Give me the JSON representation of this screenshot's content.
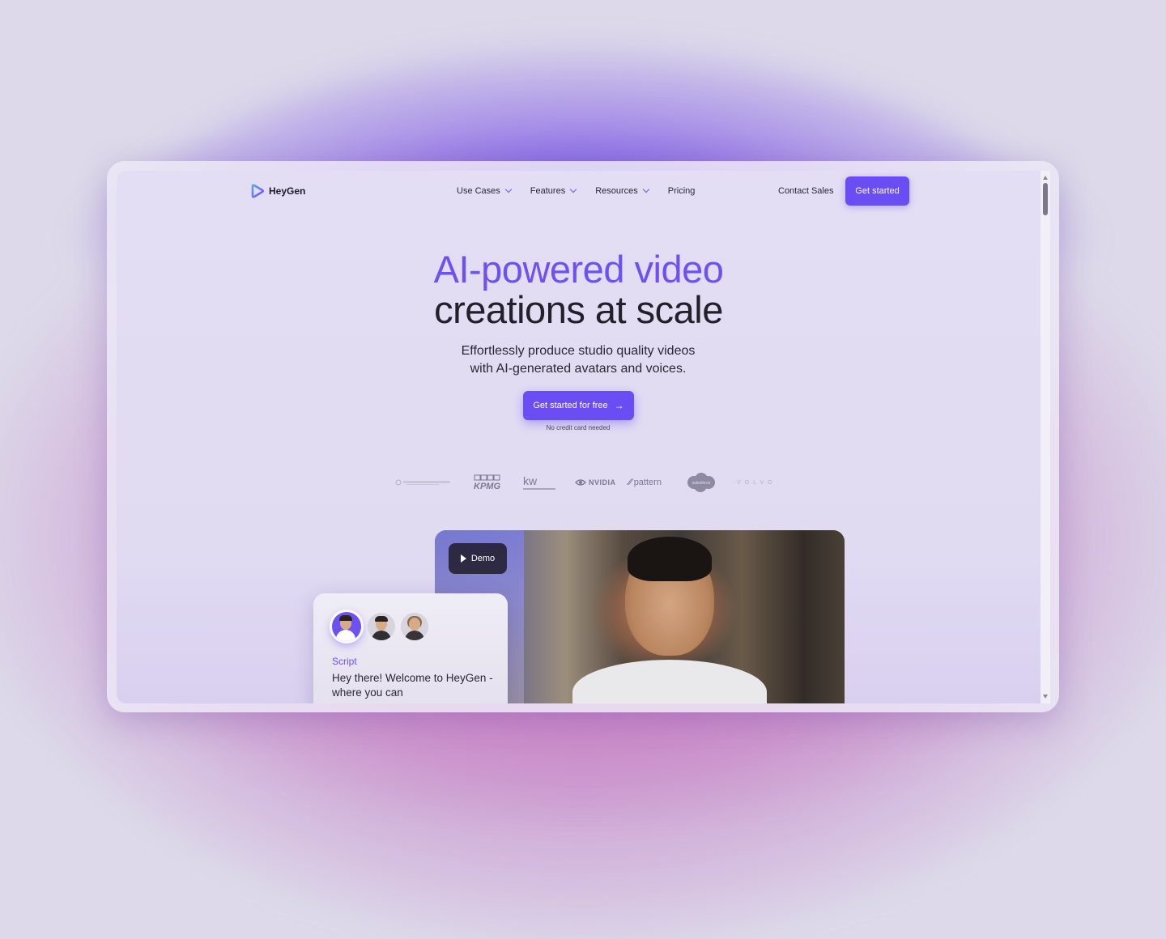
{
  "brand": {
    "name": "HeyGen",
    "accent": "#6a4ef4",
    "heading_accent": "#6c52f0"
  },
  "nav": {
    "items": [
      {
        "label": "Use Cases",
        "dropdown": true
      },
      {
        "label": "Features",
        "dropdown": true
      },
      {
        "label": "Resources",
        "dropdown": true
      },
      {
        "label": "Pricing",
        "dropdown": false
      }
    ],
    "contact_label": "Contact Sales",
    "cta_label": "Get started"
  },
  "hero": {
    "title_line1": "AI-powered video",
    "title_line2": "creations at scale",
    "subtitle_line1": "Effortlessly produce studio quality videos",
    "subtitle_line2": "with AI-generated avatars and voices.",
    "cta_label": "Get started for free",
    "note": "No credit card needed"
  },
  "logos": [
    {
      "name": "university-logo",
      "text": ""
    },
    {
      "name": "kpmg-logo",
      "text": "KPMG"
    },
    {
      "name": "keller-williams-logo",
      "text": "kw"
    },
    {
      "name": "nvidia-logo",
      "text": "NVIDIA"
    },
    {
      "name": "pattern-logo",
      "text": "pattern"
    },
    {
      "name": "salesforce-logo",
      "text": "salesforce"
    },
    {
      "name": "volvo-logo",
      "text": "VOLVO"
    }
  ],
  "demo": {
    "button_label": "Demo",
    "script_label": "Script",
    "script_text": "Hey there! Welcome to HeyGen - where you can"
  }
}
